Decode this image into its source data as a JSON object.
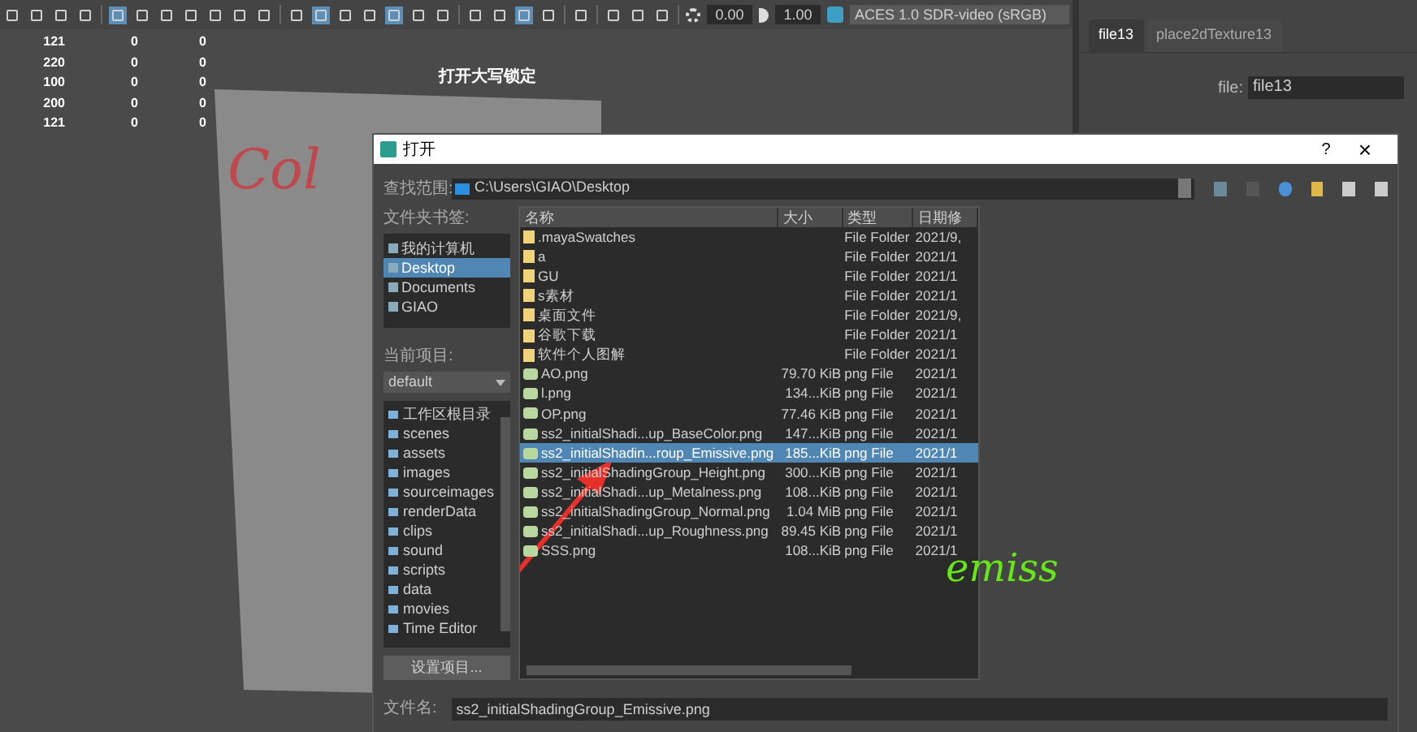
{
  "toolbar": {
    "groups": [
      [
        {
          "selected": false
        },
        {
          "selected": false
        },
        {
          "selected": false
        },
        {
          "selected": false
        }
      ],
      [
        {
          "selected": true
        },
        {
          "selected": false
        },
        {
          "selected": false
        },
        {
          "selected": false
        },
        {
          "selected": false
        },
        {
          "selected": false
        },
        {
          "selected": false
        }
      ],
      [
        {
          "selected": false
        },
        {
          "selected": true
        },
        {
          "selected": false
        },
        {
          "selected": false
        },
        {
          "selected": true
        },
        {
          "selected": false
        },
        {
          "selected": false
        }
      ],
      [
        {
          "selected": false
        },
        {
          "selected": false
        },
        {
          "selected": true
        },
        {
          "selected": false
        }
      ],
      [
        {
          "selected": false
        }
      ],
      [
        {
          "selected": false
        },
        {
          "selected": false
        },
        {
          "selected": false
        }
      ]
    ],
    "exposure": "0.00",
    "gamma": "1.00",
    "color_space": "ACES 1.0 SDR-video (sRGB)"
  },
  "stats": [
    [
      "121",
      "0",
      "0"
    ],
    [
      "220",
      "0",
      "0"
    ],
    [
      "100",
      "0",
      "0"
    ],
    [
      "200",
      "0",
      "0"
    ],
    [
      "121",
      "0",
      "0"
    ]
  ],
  "viewport_label": "打开大写锁定",
  "attribute_editor": {
    "tabs": [
      {
        "label": "file13",
        "selected": true
      },
      {
        "label": "place2dTexture13",
        "selected": false
      }
    ],
    "file_label": "file:",
    "file_value": "file13"
  },
  "annotations": [
    {
      "text": "Col",
      "color": "#c0484c"
    },
    {
      "text": "emiss",
      "color": "#66e619"
    }
  ],
  "dialog": {
    "title": "打开",
    "help": "?",
    "close": "×",
    "look_in_label": "查找范围:",
    "look_in": "C:\\Users\\GIAO\\Desktop",
    "bookmarks_label": "文件夹书签:",
    "bookmarks": [
      {
        "label": "我的计算机",
        "selected": false
      },
      {
        "label": "Desktop",
        "selected": true
      },
      {
        "label": "Documents",
        "selected": false
      },
      {
        "label": "GIAO",
        "selected": false
      }
    ],
    "project_label": "当前项目:",
    "project": "default",
    "project_folders": [
      "工作区根目录",
      "scenes",
      "assets",
      "images",
      "sourceimages",
      "renderData",
      "clips",
      "sound",
      "scripts",
      "data",
      "movies",
      "Time Editor"
    ],
    "set_project": "设置项目...",
    "columns": [
      "名称",
      "大小",
      "类型",
      "日期修"
    ],
    "files": [
      {
        "kind": "folder",
        "name": ".mayaSwatches",
        "type": "File Folder",
        "date": "2021/9,",
        "selected": false
      },
      {
        "kind": "folder",
        "name": "a",
        "type": "File Folder",
        "date": "2021/1",
        "selected": false
      },
      {
        "kind": "folder",
        "name": "GU",
        "type": "File Folder",
        "date": "2021/1",
        "selected": false
      },
      {
        "kind": "folder",
        "name": "s素材",
        "type": "File Folder",
        "date": "2021/1",
        "selected": false
      },
      {
        "kind": "folder",
        "name": "桌面文件",
        "type": "File Folder",
        "date": "2021/9,",
        "selected": false
      },
      {
        "kind": "folder",
        "name": "谷歌下载",
        "type": "File Folder",
        "date": "2021/1",
        "selected": false
      },
      {
        "kind": "folder",
        "name": "软件个人图解",
        "type": "File Folder",
        "date": "2021/1",
        "selected": false
      },
      {
        "kind": "image",
        "name": "AO.png",
        "size": "79.70 KiB",
        "type": "png File",
        "date": "2021/1",
        "selected": false
      },
      {
        "kind": "image",
        "name": "l.png",
        "size": "134...KiB",
        "type": "png File",
        "date": "2021/1",
        "selected": false
      },
      {
        "kind": "image",
        "name": "OP.png",
        "size": "77.46 KiB",
        "type": "png File",
        "date": "2021/1",
        "selected": false
      },
      {
        "kind": "image",
        "name": "ss2_initialShadi...up_BaseColor.png",
        "size": "147...KiB",
        "type": "png File",
        "date": "2021/1",
        "selected": false
      },
      {
        "kind": "image",
        "name": "ss2_initialShadin...roup_Emissive.png",
        "size": "185...KiB",
        "type": "png File",
        "date": "2021/1",
        "selected": true
      },
      {
        "kind": "image",
        "name": "ss2_initialShadingGroup_Height.png",
        "size": "300...KiB",
        "type": "png File",
        "date": "2021/1",
        "selected": false
      },
      {
        "kind": "image",
        "name": "ss2_initialShadi...up_Metalness.png",
        "size": "108...KiB",
        "type": "png File",
        "date": "2021/1",
        "selected": false
      },
      {
        "kind": "image",
        "name": "ss2_initialShadingGroup_Normal.png",
        "size": "1.04 MiB",
        "type": "png File",
        "date": "2021/1",
        "selected": false
      },
      {
        "kind": "image",
        "name": "ss2_initialShadi...up_Roughness.png",
        "size": "89.45 KiB",
        "type": "png File",
        "date": "2021/1",
        "selected": false
      },
      {
        "kind": "image",
        "name": "SSS.png",
        "size": "108...KiB",
        "type": "png File",
        "date": "2021/1",
        "selected": false
      }
    ],
    "file_name_label": "文件名:",
    "file_name": "ss2_initialShadingGroup_Emissive.png"
  }
}
